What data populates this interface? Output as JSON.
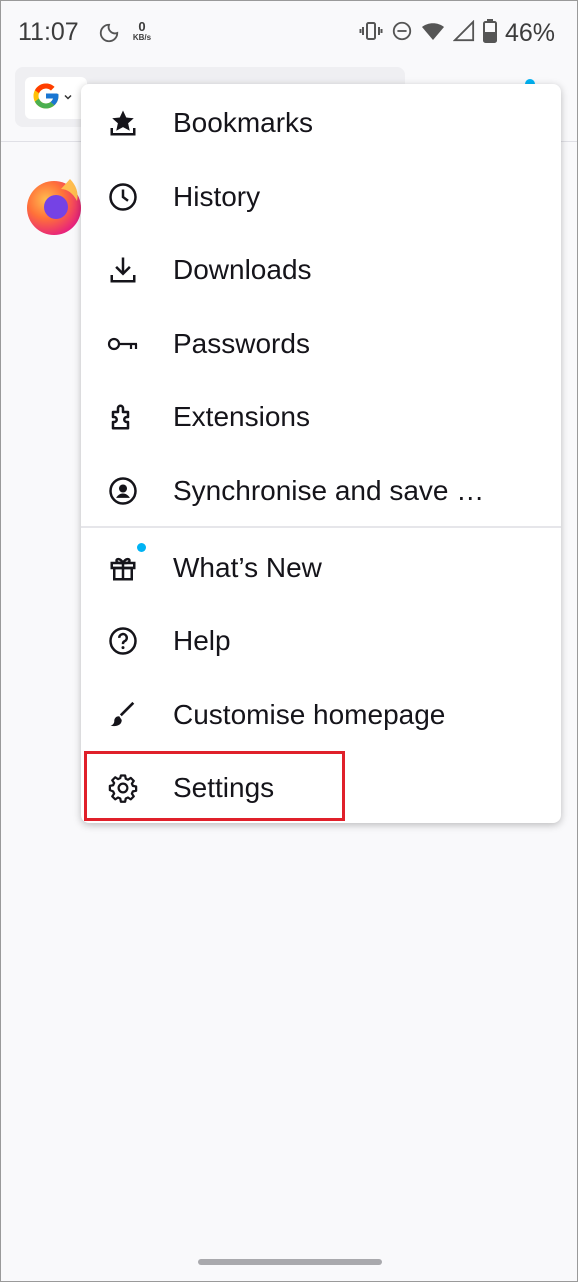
{
  "status_bar": {
    "time": "11:07",
    "net_speed_value": "0",
    "net_speed_unit": "KB/s",
    "battery": "46%"
  },
  "menu": {
    "items": [
      {
        "label": "Bookmarks",
        "icon": "bookmark-star-icon"
      },
      {
        "label": "History",
        "icon": "clock-icon"
      },
      {
        "label": "Downloads",
        "icon": "download-icon"
      },
      {
        "label": "Passwords",
        "icon": "key-icon"
      },
      {
        "label": "Extensions",
        "icon": "puzzle-icon"
      },
      {
        "label": "Synchronise and save …",
        "icon": "account-icon"
      },
      {
        "label": "What’s New",
        "icon": "gift-icon"
      },
      {
        "label": "Help",
        "icon": "help-icon"
      },
      {
        "label": "Customise homepage",
        "icon": "brush-icon"
      },
      {
        "label": "Settings",
        "icon": "gear-icon"
      }
    ]
  },
  "colors": {
    "accent_dot": "#00b3f4",
    "highlight_box": "#e0202a",
    "background": "#f9f9fb"
  }
}
